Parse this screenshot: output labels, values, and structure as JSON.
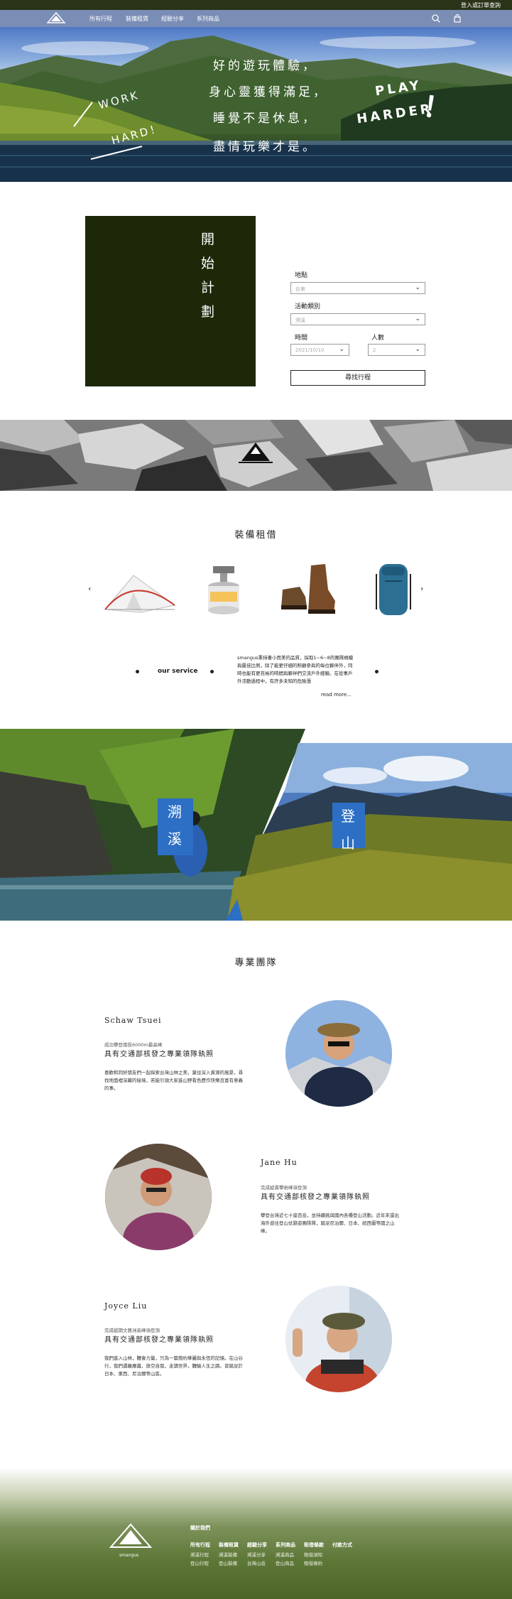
{
  "topbar": {
    "login_text": "登入或訂單查詢"
  },
  "nav": {
    "logo_icon": "mountain-logo-icon",
    "items": [
      {
        "label": "所有行程"
      },
      {
        "label": "裝備租賃"
      },
      {
        "label": "經驗分享"
      },
      {
        "label": "系列商品"
      }
    ],
    "search_icon": "search-icon",
    "cart_icon": "bag-icon"
  },
  "hero": {
    "lines": [
      "好的遊玩體驗，",
      "身心靈獲得滿足，",
      "睡覺不是休息，",
      "盡情玩樂才是。"
    ],
    "work": "WORK",
    "hard": "HARD！",
    "play": "PLAY",
    "harder": "HARDER",
    "exclaim": "！"
  },
  "plan": {
    "title": "開 始 計 劃",
    "location_label": "地點",
    "location_value": "台東",
    "activity_label": "活動類別",
    "activity_value": "溯溪",
    "date_label": "時間",
    "date_value": "2021/10/10",
    "people_label": "人數",
    "people_value": "2",
    "search_button": "尋找行程"
  },
  "equipment": {
    "title": "裝備租借",
    "prev_icon": "chevron-left-icon",
    "next_icon": "chevron-right-icon",
    "items": [
      "tent",
      "gas-stove",
      "hiking-boots",
      "backpack"
    ]
  },
  "service": {
    "label": "our service",
    "text": "smangus秉持著小而美的品質，採取1~6~8的團隊規模與最佳比例，除了能更仔細的照顧參與的每位夥伴外，同時也能有更充裕的時間與夥伴們交流戶外經驗。在從事戶外活動過程中，有許多未知的危險潛",
    "read_more": "read more..."
  },
  "activities": [
    {
      "label": "溯溪"
    },
    {
      "label": "登山"
    }
  ],
  "team": {
    "title": "專業團隊",
    "members": [
      {
        "name": "Schaw Tsuei",
        "sub": "成功攀登南投6000m最高峰",
        "role": "具有交通部核發之專業領隊執照",
        "desc": "喜歡和同好朋友們一起探索台灣山林之美，棄往深入資源的風景，尋找地面裡深藏的秘境，若能引領大家進山野看色歷作快樂且富有意義的事。"
      },
      {
        "name": "Jane Hu",
        "sub": "完成縱貫攀岩峰嶺登頂",
        "role": "具有交通部核發之專業領隊執照",
        "desc": "攀登台灣近七十座百岳，並持續挑與國內各種登山活動。近年來還出海外遊住登山仗跡遊團隊隊，踏足尼泊爾、日本、紐西蘭等國之山峰。"
      },
      {
        "name": "Joyce Liu",
        "sub": "完成縱期文藝洲高峰嶺登頂",
        "role": "具有交通部核發之專業領隊執照",
        "desc": "我們進入山林，體會力量，只為一篇簡約華麗與永恆的記憶。在山谷行，我們遇離塵囂，放空自我，走讀世界，體驗人生之路。曾踏足於日本、東西、尼泊爾等山區。"
      }
    ]
  },
  "footer": {
    "brand": "smangus",
    "about": "關於我們",
    "columns": [
      {
        "heading": "所有行程",
        "items": [
          "溯溪行程",
          "登山行程"
        ]
      },
      {
        "heading": "裝備租賃",
        "items": [
          "溯溪裝備",
          "登山裝備"
        ]
      },
      {
        "heading": "經驗分享",
        "items": [
          "溯溪分享",
          "台灣山岳"
        ]
      },
      {
        "heading": "系列商品",
        "items": [
          "溯溪商品",
          "登山商品"
        ]
      },
      {
        "heading": "租借條款",
        "items": [
          "租借須知",
          "租借條約"
        ]
      },
      {
        "heading": "付款方式",
        "items": []
      }
    ]
  },
  "colors": {
    "nav": "#7a8db5",
    "dark_green": "#1d2809",
    "accent_blue": "#2c6fc4",
    "footer_green": "#5e7838"
  }
}
